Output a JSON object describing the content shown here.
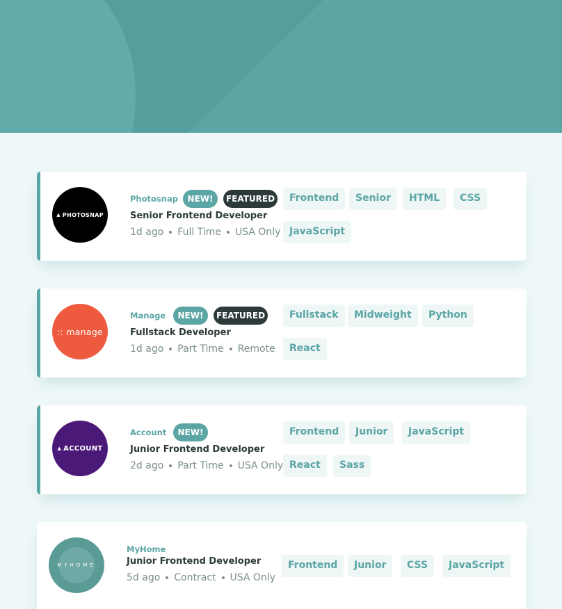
{
  "colors": {
    "primary": "#5ca5a5",
    "background": "#eff8f8",
    "tag_bg": "#eef6f6",
    "dark": "#2c3a3a",
    "gray": "#7b8e8e"
  },
  "jobs": [
    {
      "company": "Photosnap",
      "logo_text": "PHOTOSNAP",
      "new_label": "NEW!",
      "featured_label": "FEATURED",
      "position": "Senior Frontend Developer",
      "posted": "1d ago",
      "contract": "Full Time",
      "location": "USA Only",
      "tags": [
        "Frontend",
        "Senior",
        "HTML",
        "CSS",
        "JavaScript"
      ]
    },
    {
      "company": "Manage",
      "logo_text": ":: manage",
      "new_label": "NEW!",
      "featured_label": "FEATURED",
      "position": "Fullstack Developer",
      "posted": "1d ago",
      "contract": "Part Time",
      "location": "Remote",
      "tags": [
        "Fullstack",
        "Midweight",
        "Python",
        "React"
      ]
    },
    {
      "company": "Account",
      "logo_text": "ACCOUNT",
      "new_label": "NEW!",
      "position": "Junior Frontend Developer",
      "posted": "2d ago",
      "contract": "Part Time",
      "location": "USA Only",
      "tags": [
        "Frontend",
        "Junior",
        "JavaScript",
        "React",
        "Sass"
      ]
    },
    {
      "company": "MyHome",
      "logo_text": "MYHOME",
      "position": "Junior Frontend Developer",
      "posted": "5d ago",
      "contract": "Contract",
      "location": "USA Only",
      "tags": [
        "Frontend",
        "Junior",
        "CSS",
        "JavaScript"
      ]
    }
  ]
}
